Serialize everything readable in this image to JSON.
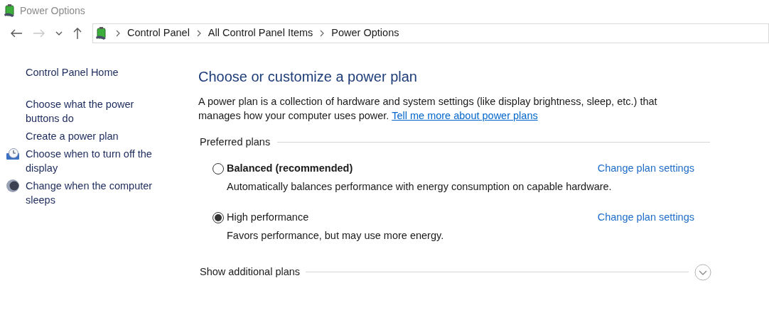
{
  "window": {
    "title": "Power Options"
  },
  "address_bar": {
    "crumbs": [
      "Control Panel",
      "All Control Panel Items",
      "Power Options"
    ]
  },
  "sidebar": {
    "home": "Control Panel Home",
    "items": [
      {
        "label": "Choose what the power buttons do",
        "kind": "plain"
      },
      {
        "label": "Create a power plan",
        "kind": "plain"
      },
      {
        "label": "Choose when to turn off the display",
        "kind": "display"
      },
      {
        "label": "Change when the computer sleeps",
        "kind": "sleep"
      }
    ]
  },
  "main": {
    "heading": "Choose or customize a power plan",
    "intro": "A power plan is a collection of hardware and system settings (like display brightness, sleep, etc.) that manages how your computer uses power.",
    "intro_link": "Tell me more about power plans",
    "preferred_plans": {
      "title": "Preferred plans",
      "plans": [
        {
          "name": "Balanced (recommended)",
          "emphasized": true,
          "selected": false,
          "link": "Change plan settings",
          "description": "Automatically balances performance with energy consumption on capable hardware."
        },
        {
          "name": "High performance",
          "emphasized": false,
          "selected": true,
          "link": "Change plan settings",
          "description": "Favors performance, but may use more energy."
        }
      ]
    },
    "additional_plans": {
      "title": "Show additional plans",
      "expanded": false
    }
  }
}
